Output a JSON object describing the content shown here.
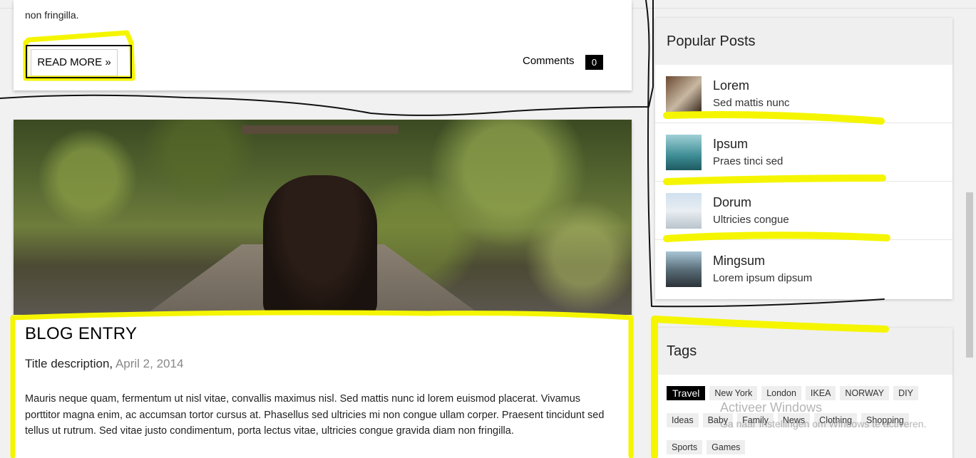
{
  "prev_post": {
    "tail_text": "non fringilla.",
    "read_more": "READ MORE »",
    "comments_label": "Comments",
    "comments_count": "0"
  },
  "entry": {
    "title": "BLOG ENTRY",
    "subtitle": "Title description,",
    "date": "April 2, 2014",
    "body": "Mauris neque quam, fermentum ut nisl vitae, convallis maximus nisl. Sed mattis nunc id lorem euismod placerat. Vivamus porttitor magna enim, ac accumsan tortor cursus at. Phasellus sed ultricies mi non congue ullam corper. Praesent tincidunt sed tellus ut rutrum. Sed vitae justo condimentum, porta lectus vitae, ultricies congue gravida diam non fringilla."
  },
  "sidebar": {
    "popular_title": "Popular Posts",
    "posts": [
      {
        "title": "Lorem",
        "subtitle": "Sed mattis nunc"
      },
      {
        "title": "Ipsum",
        "subtitle": "Praes tinci sed"
      },
      {
        "title": "Dorum",
        "subtitle": "Ultricies congue"
      },
      {
        "title": "Mingsum",
        "subtitle": "Lorem ipsum dipsum"
      }
    ],
    "tags_title": "Tags",
    "tag_rows": [
      [
        "Travel",
        "New York",
        "London",
        "IKEA",
        "NORWAY",
        "DIY"
      ],
      [
        "Ideas",
        "Baby",
        "Family",
        "News",
        "Clothing",
        "Shopping"
      ],
      [
        "Sports",
        "Games"
      ]
    ]
  },
  "watermark": {
    "line1": "Activeer Windows",
    "line2": "Ga naar Instellingen om Windows te activeren."
  },
  "colors": {
    "highlight": "#f5f500",
    "pen": "#111111",
    "active_tag": "#000000"
  }
}
